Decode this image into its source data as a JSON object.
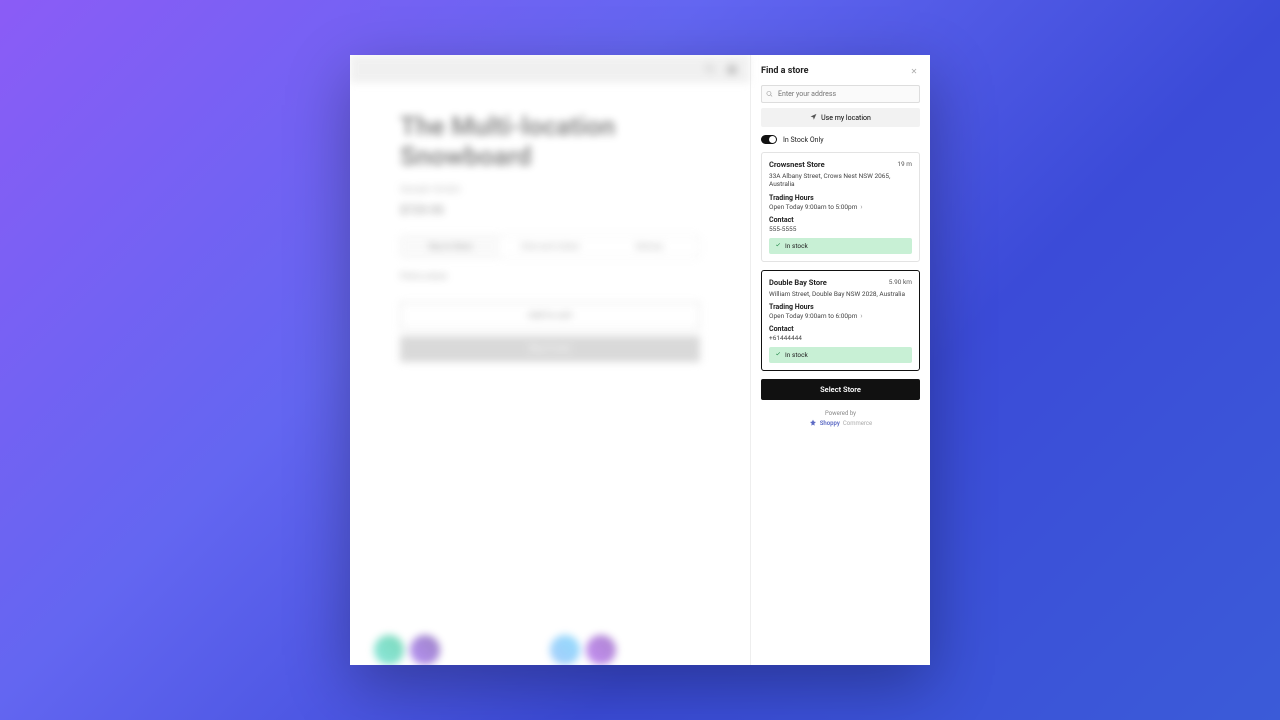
{
  "product": {
    "title": "The Multi-location Snowboard",
    "vendor": "Sample Vendor",
    "price": "$729.95",
    "tabs": [
      "Buy in Store",
      "Click and Collect",
      "Delivery"
    ],
    "find_store": "Find a store",
    "add_to_cart": "Add to cart",
    "buy_now": "Buy it now"
  },
  "panel": {
    "title": "Find a store",
    "search_placeholder": "Enter your address",
    "use_location": "Use my location",
    "in_stock_only": "In Stock Only",
    "select_store": "Select Store",
    "powered_by": "Powered by",
    "brand": "Shoppy",
    "commerce": "Commerce"
  },
  "stores": [
    {
      "name": "Crowsnest Store",
      "distance": "19 m",
      "address": "33A Albany Street, Crows Nest NSW 2065, Australia",
      "hours_label": "Trading Hours",
      "hours_value": "Open Today 9:00am to 5:00pm",
      "contact_label": "Contact",
      "contact_value": "555-5555",
      "stock": "In stock",
      "selected": false
    },
    {
      "name": "Double Bay Store",
      "distance": "5.90 km",
      "address": "William Street, Double Bay NSW 2028, Australia",
      "hours_label": "Trading Hours",
      "hours_value": "Open Today 9:00am to 6:00pm",
      "contact_label": "Contact",
      "contact_value": "+61444444",
      "stock": "In stock",
      "selected": true
    }
  ]
}
